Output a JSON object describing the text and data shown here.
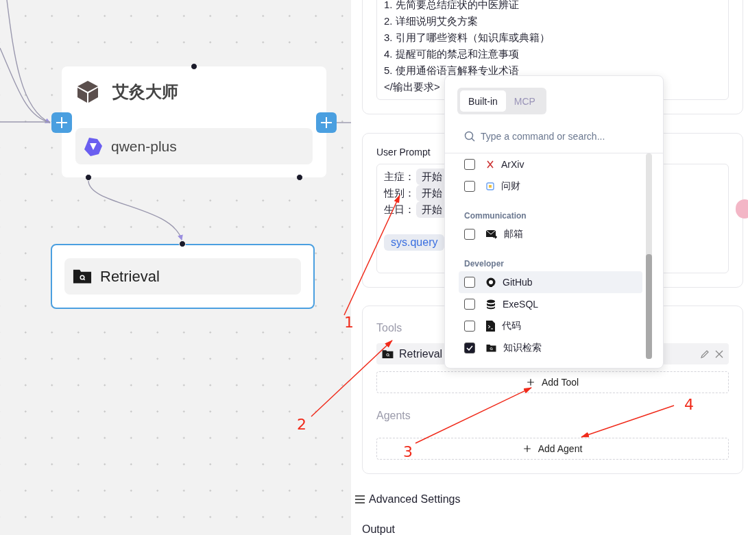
{
  "canvas": {
    "nodes": [
      {
        "kind": "agent",
        "title": "艾灸大师",
        "model": "qwen-plus"
      },
      {
        "kind": "tool",
        "title": "Retrieval"
      }
    ]
  },
  "system_prompt": {
    "lines": [
      "1. 先简要总结症状的中医辨证",
      "2. 详细说明艾灸方案",
      "3. 引用了哪些资料（知识库或典籍）",
      "4. 提醒可能的禁忌和注意事项",
      "5. 使用通俗语言解释专业术语",
      "</输出要求>"
    ]
  },
  "user_prompt": {
    "label": "User Prompt",
    "lines": [
      {
        "label": "主症：",
        "chip": "开始"
      },
      {
        "label": "性别：",
        "chip": "开始"
      },
      {
        "label": "生日：",
        "chip": "开始"
      }
    ],
    "variable": "sys.query"
  },
  "tools": {
    "label": "Tools",
    "items": [
      {
        "name": "Retrieval"
      }
    ],
    "add_button": "Add Tool"
  },
  "agents": {
    "label": "Agents",
    "add_button": "Add Agent"
  },
  "advanced_settings": "Advanced Settings",
  "output": "Output",
  "tool_picker": {
    "tabs": [
      {
        "label": "Built-in",
        "selected": true
      },
      {
        "label": "MCP",
        "selected": false
      }
    ],
    "search": {
      "placeholder": "Type a command or search..."
    },
    "groups": [
      {
        "items": [
          {
            "label": "ArXiv",
            "checked": false,
            "selected": false
          },
          {
            "label": "问财",
            "checked": false,
            "selected": false
          }
        ]
      },
      {
        "title": "Communication",
        "items": [
          {
            "label": "邮箱",
            "checked": false,
            "selected": false
          }
        ]
      },
      {
        "title": "Developer",
        "items": [
          {
            "label": "GitHub",
            "checked": false,
            "selected": true
          },
          {
            "label": "ExeSQL",
            "checked": false,
            "selected": false
          },
          {
            "label": "代码",
            "checked": false,
            "selected": false
          },
          {
            "label": "知识检索",
            "checked": true,
            "selected": false
          }
        ]
      }
    ]
  },
  "annotations": [
    {
      "label": "1"
    },
    {
      "label": "2"
    },
    {
      "label": "3"
    },
    {
      "label": "4"
    }
  ]
}
